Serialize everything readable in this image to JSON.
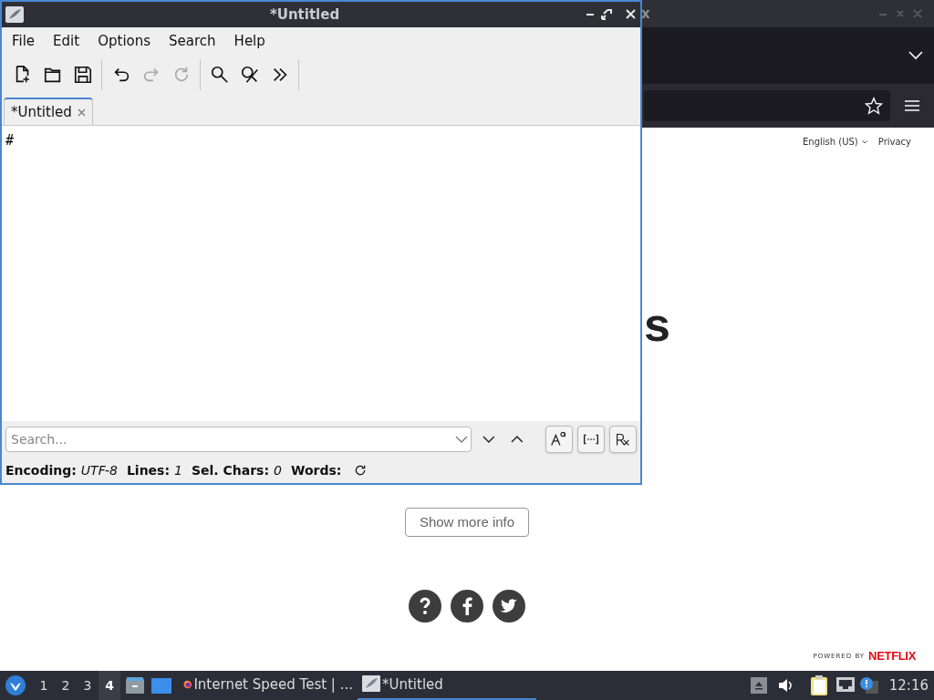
{
  "browser": {
    "title": "x",
    "language": "English (US)",
    "privacy": "Privacy",
    "heading": "s",
    "more_button": "Show more info",
    "footer_links": [
      {
        "kind": "help"
      },
      {
        "kind": "facebook"
      },
      {
        "kind": "twitter"
      }
    ],
    "powered_by": "POWERED BY",
    "brand": "NETFLIX"
  },
  "editor": {
    "title": "*Untitled",
    "menu": [
      "File",
      "Edit",
      "Options",
      "Search",
      "Help"
    ],
    "toolbar": [
      [
        {
          "kind": "new",
          "disabled": false
        },
        {
          "kind": "open",
          "disabled": false
        },
        {
          "kind": "save",
          "disabled": false
        }
      ],
      [
        {
          "kind": "undo",
          "disabled": false
        },
        {
          "kind": "redo",
          "disabled": true
        },
        {
          "kind": "reload",
          "disabled": true
        }
      ],
      [
        {
          "kind": "find",
          "disabled": false
        },
        {
          "kind": "replace",
          "disabled": false
        },
        {
          "kind": "more",
          "disabled": false
        }
      ]
    ],
    "tabs": [
      {
        "label": "*Untitled",
        "selected": true
      }
    ],
    "content": "#",
    "search": {
      "placeholder": "Search..."
    },
    "search_toggles": [
      {
        "kind": "case"
      },
      {
        "kind": "whole"
      },
      {
        "kind": "regex"
      }
    ],
    "status": [
      {
        "label": "Encoding:",
        "value": "UTF-8"
      },
      {
        "label": "Lines:",
        "value": "1"
      },
      {
        "label": "Sel. Chars:",
        "value": "0"
      },
      {
        "label": "Words:"
      }
    ]
  },
  "taskbar": {
    "workspaces": [
      {
        "label": "1",
        "selected": false
      },
      {
        "label": "2",
        "selected": false
      },
      {
        "label": "3",
        "selected": false
      },
      {
        "label": "4",
        "selected": true
      }
    ],
    "tasks": [
      {
        "kind": "firefox",
        "label": "Internet Speed Test | ...",
        "selected": false
      },
      {
        "kind": "editor",
        "label": "*Untitled",
        "selected": true
      }
    ],
    "clock": "12:16"
  }
}
